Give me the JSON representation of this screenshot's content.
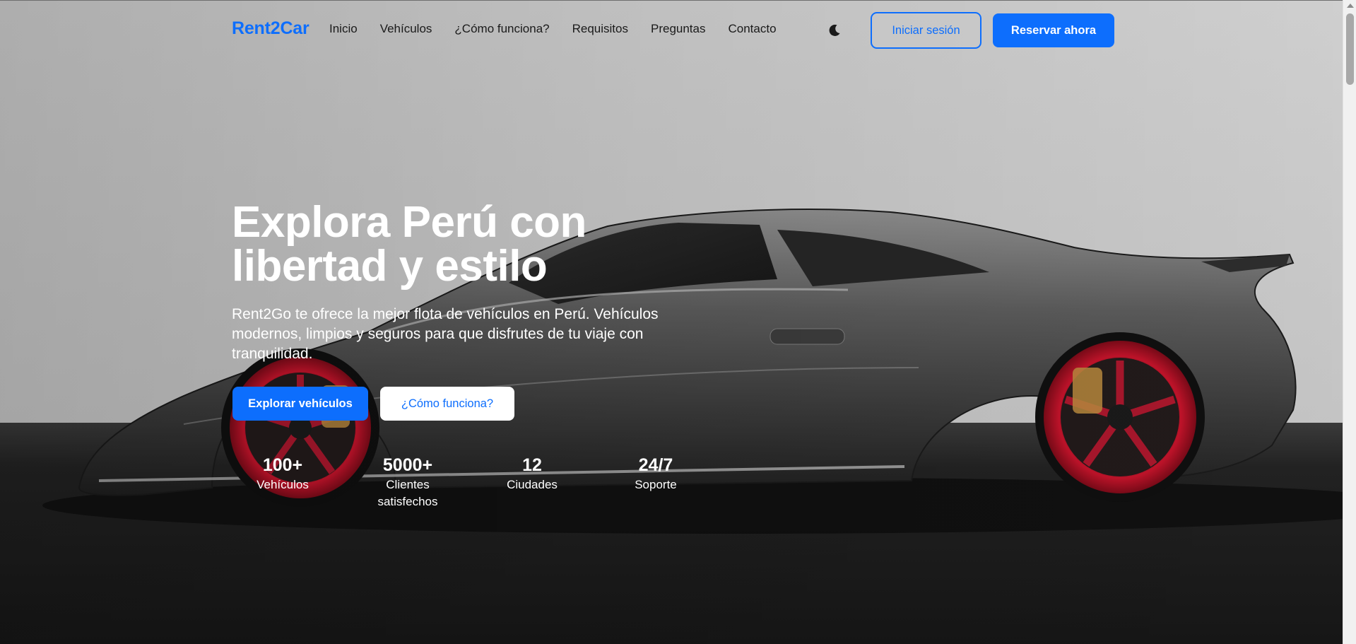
{
  "colors": {
    "brand": "#0d6efd",
    "nav_text": "#1a1a1a",
    "hero_text": "#ffffff"
  },
  "header": {
    "logo": "Rent2Car",
    "nav": [
      {
        "label": "Inicio"
      },
      {
        "label": "Vehículos"
      },
      {
        "label": "¿Cómo funciona?"
      },
      {
        "label": "Requisitos"
      },
      {
        "label": "Preguntas"
      },
      {
        "label": "Contacto"
      }
    ],
    "theme_icon": "moon-icon",
    "login_label": "Iniciar sesión",
    "reserve_label": "Reservar ahora"
  },
  "hero": {
    "background": "sports-car-photo",
    "title": "Explora Perú con libertad y estilo",
    "subtitle": "Rent2Go te ofrece la mejor flota de vehículos en Perú. Vehículos modernos, limpios y seguros para que disfrutes de tu viaje con tranquilidad.",
    "explore_label": "Explorar vehículos",
    "how_label": "¿Cómo funciona?",
    "stats": [
      {
        "value": "100+",
        "label": "Vehículos"
      },
      {
        "value": "5000+",
        "label": "Clientes satisfechos"
      },
      {
        "value": "12",
        "label": "Ciudades"
      },
      {
        "value": "24/7",
        "label": "Soporte"
      }
    ]
  }
}
